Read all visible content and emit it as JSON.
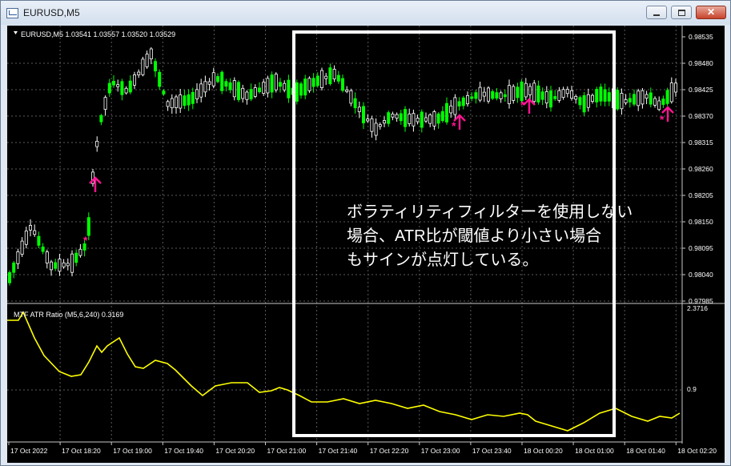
{
  "window": {
    "title": "EURUSD,M5"
  },
  "main_chart": {
    "header": "EURUSD,M5  1.03541 1.03557 1.03520 1.03529",
    "price_ticks": [
      "0.98535",
      "0.98480",
      "0.98425",
      "0.98370",
      "0.98315",
      "0.98260",
      "0.98205",
      "0.98150",
      "0.98095",
      "0.98040",
      "0.97985"
    ]
  },
  "indicator": {
    "header": "MTF ATR Ratio  (M5,6,240) 0.3169",
    "ticks": [
      "2.3716",
      "0.9"
    ]
  },
  "time_axis": [
    "17 Oct 2022",
    "17 Oct 18:20",
    "17 Oct 19:00",
    "17 Oct 19:40",
    "17 Oct 20:20",
    "17 Oct 21:00",
    "17 Oct 21:40",
    "17 Oct 22:20",
    "17 Oct 23:00",
    "17 Oct 23:40",
    "18 Oct 00:20",
    "18 Oct 01:00",
    "18 Oct 01:40",
    "18 Oct 02:20"
  ],
  "annotation": "ボラティリティフィルターを使用しない\n場合、ATR比が閾値より小さい場合\nもサインが点灯している。",
  "colors": {
    "bull": "#00ff00",
    "bear": "#ffffff",
    "signal": "#ff1493",
    "indicator_line": "#ffff00",
    "highlight": "#ffffff"
  }
}
